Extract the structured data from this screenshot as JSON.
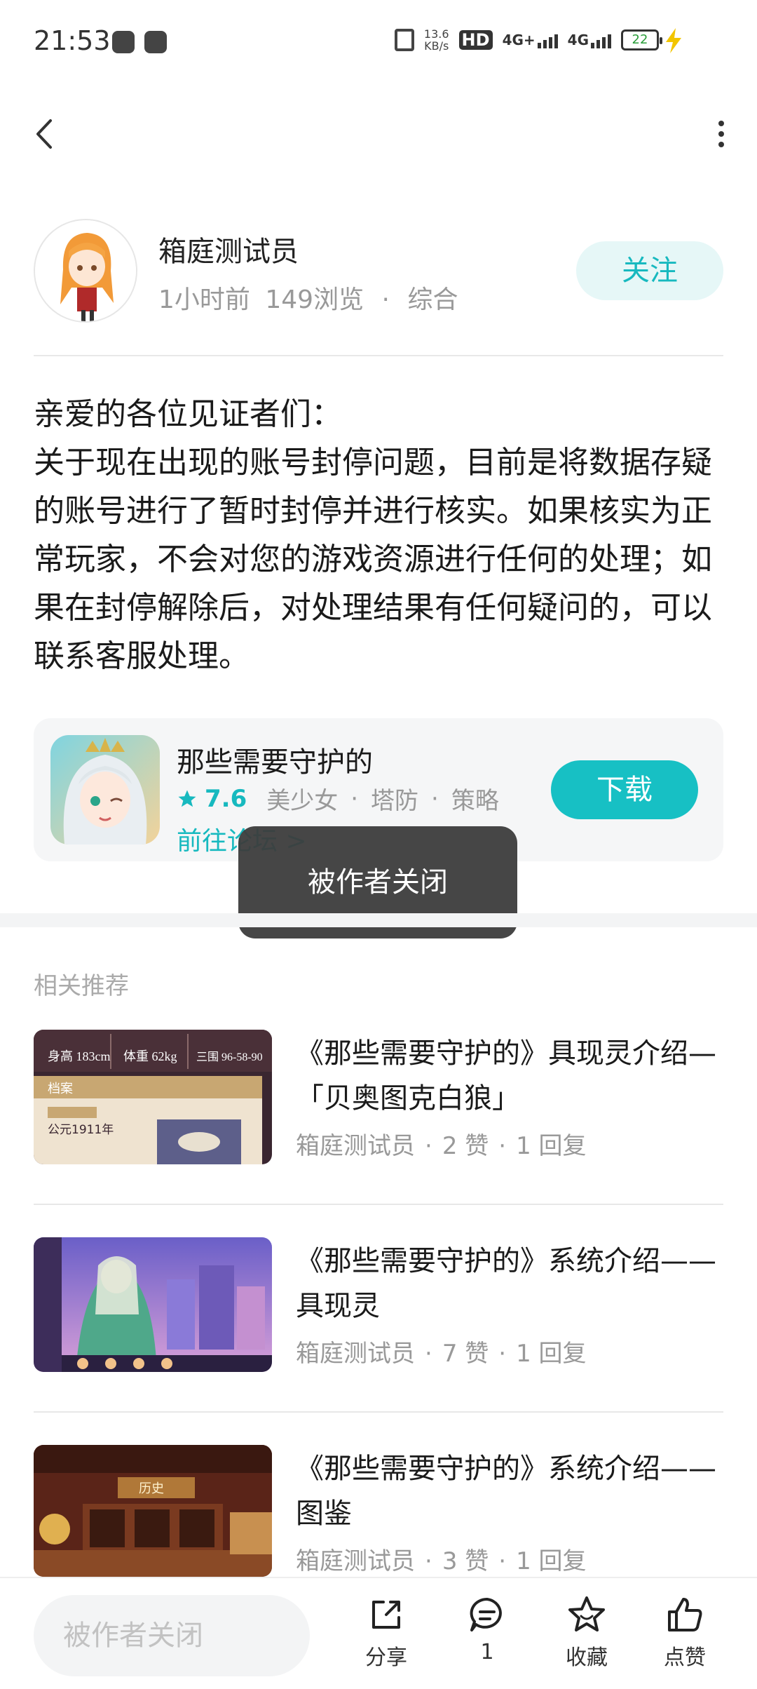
{
  "status_bar": {
    "time": "21:53",
    "net_speed": "13.6",
    "net_unit": "KB/s",
    "hd_label": "HD",
    "sim1_label": "4G+",
    "sim2_label": "4G",
    "battery": "22"
  },
  "author": {
    "name": "箱庭测试员",
    "time_ago": "1小时前",
    "views": "149浏览",
    "separator": "·",
    "category": "综合",
    "follow_label": "关注"
  },
  "post": {
    "body": "亲爱的各位见证者们：\n关于现在出现的账号封停问题，目前是将数据存疑的账号进行了暂时封停并进行核实。如果核实为正常玩家，不会对您的游戏资源进行任何的处理；如果在封停解除后，对处理结果有任何疑问的，可以联系客服处理。"
  },
  "game_card": {
    "name": "那些需要守护的",
    "rating": "7.6",
    "tag1": "美少女",
    "tag2": "塔防",
    "tag3": "策略",
    "tag_separator": "·",
    "forum_link": "前往论坛 >",
    "download_label": "下载"
  },
  "toast": {
    "message": "被作者关闭"
  },
  "related": {
    "section_title": "相关推荐",
    "items": [
      {
        "title": "《那些需要守护的》具现灵介绍—「贝奥图克白狼」",
        "author": "箱庭测试员",
        "likes": "2 赞",
        "replies": "1 回复",
        "thumb_text_1": "身高 183cm",
        "thumb_text_2": "体重 62kg",
        "thumb_text_3": "三围 96-58-90",
        "thumb_text_4": "档案",
        "thumb_text_5": "公元1911年"
      },
      {
        "title": "《那些需要守护的》系统介绍——具现灵",
        "author": "箱庭测试员",
        "likes": "7 赞",
        "replies": "1 回复"
      },
      {
        "title": "《那些需要守护的》系统介绍——图鉴",
        "author": "箱庭测试员",
        "likes": "3 赞",
        "replies": "1 回复",
        "thumb_text_1": "历史"
      }
    ],
    "meta_separator": "·"
  },
  "bottom_bar": {
    "input_placeholder": "被作者关闭",
    "share_label": "分享",
    "comment_count": "1",
    "collect_label": "收藏",
    "like_label": "点赞"
  },
  "colors": {
    "accent": "#17c0c4",
    "accent_light": "#e6f7f7",
    "text_primary": "#1a1a1a",
    "text_secondary": "#999999",
    "toast_bg": "#3c3c3c"
  },
  "icons": {
    "back": "chevron-left-icon",
    "more": "more-vertical-icon",
    "share": "share-external-icon",
    "comment": "chat-bubble-icon",
    "collect": "star-outline-icon",
    "like": "thumb-up-icon"
  }
}
